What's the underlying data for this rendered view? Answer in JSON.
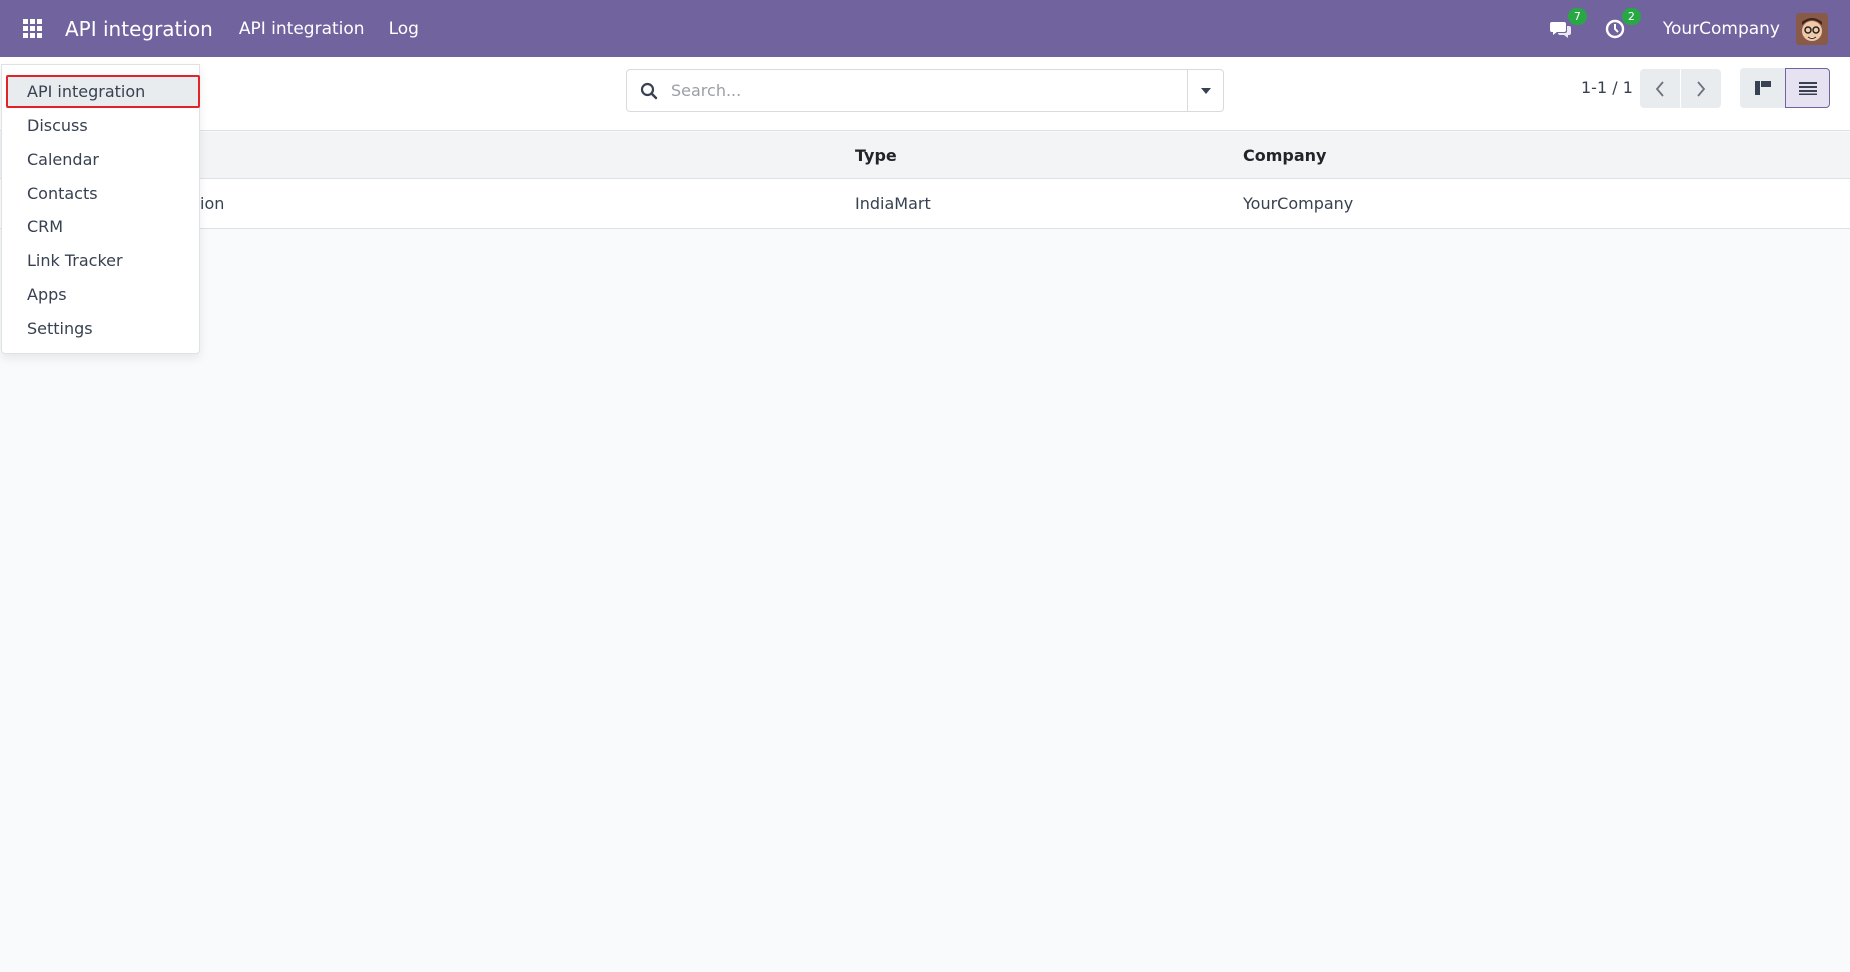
{
  "navbar": {
    "brand": "API integration",
    "menu": [
      "API integration",
      "Log"
    ],
    "messages_count": "7",
    "activities_count": "2",
    "company": "YourCompany"
  },
  "control_panel": {
    "search_placeholder": "Search...",
    "pager": "1-1 / 1"
  },
  "table": {
    "headers": [
      "Type",
      "Company"
    ],
    "rows": [
      {
        "name": "ion",
        "type": "IndiaMart",
        "company": "YourCompany"
      }
    ]
  },
  "apps_dropdown": {
    "items": [
      "API integration",
      "Discuss",
      "Calendar",
      "Contacts",
      "CRM",
      "Link Tracker",
      "Apps",
      "Settings"
    ],
    "active_item": "API integration"
  },
  "colors": {
    "navbar": "#71639e",
    "badge": "#28a745",
    "highlight_border": "#e0242a"
  },
  "icons": [
    "apps-grid-icon",
    "chat-icon",
    "clock-icon",
    "search-icon",
    "caret-down-icon",
    "chevron-left-icon",
    "chevron-right-icon",
    "kanban-view-icon",
    "list-view-icon"
  ]
}
